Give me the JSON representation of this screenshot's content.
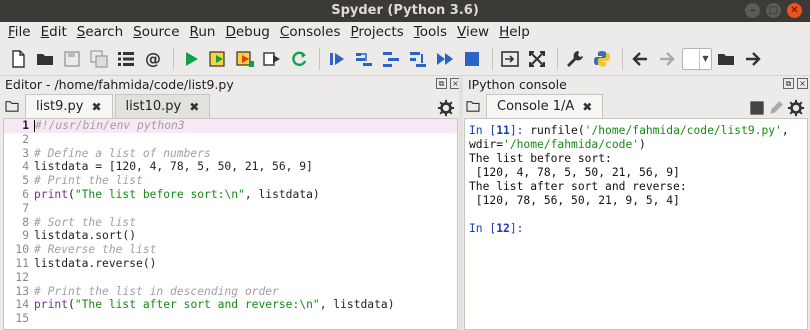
{
  "window": {
    "title": "Spyder (Python 3.6)"
  },
  "menu": [
    "File",
    "Edit",
    "Search",
    "Source",
    "Run",
    "Debug",
    "Consoles",
    "Projects",
    "Tools",
    "View",
    "Help"
  ],
  "editor": {
    "header": "Editor - /home/fahmida/code/list9.py",
    "tabs": [
      {
        "label": "list9.py",
        "active": true
      },
      {
        "label": "list10.py",
        "active": false
      }
    ],
    "lines": [
      "#!/usr/bin/env python3",
      "",
      "# Define a list of numbers",
      "listdata = [120, 4, 78, 5, 50, 21, 56, 9]",
      "# Print the list",
      "print(\"The list before sort:\\n\", listdata)",
      "",
      "# Sort the list",
      "listdata.sort()",
      "# Reverse the list",
      "listdata.reverse()",
      "",
      "# Print the list in descending order",
      "print(\"The list after sort and reverse:\\n\", listdata)",
      ""
    ]
  },
  "console": {
    "header": "IPython console",
    "tab_label": "Console 1/A",
    "in_11_prompt": "In [",
    "in_11_num": "11",
    "in_11_close": "]: ",
    "in_11_cmd_a": "runfile(",
    "in_11_path": "'/home/fahmida/code/list9.py'",
    "in_11_comma": ",",
    "in_11_kw": "wdir=",
    "in_11_wdir": "'/home/fahmida/code'",
    "in_11_end": ")",
    "out_1": "The list before sort:",
    "out_2": " [120, 4, 78, 5, 50, 21, 56, 9]",
    "out_3": "The list after sort and reverse:",
    "out_4": " [120, 78, 56, 50, 21, 9, 5, 4]",
    "in_12_prompt": "In [",
    "in_12_num": "12",
    "in_12_close": "]:"
  },
  "colors": {
    "titlebar": "#3b3a36",
    "comment": "#a0a0a0",
    "string": "#168a16",
    "keyword_builtin": "#7a2f8f",
    "prompt": "#1c3ab8"
  }
}
